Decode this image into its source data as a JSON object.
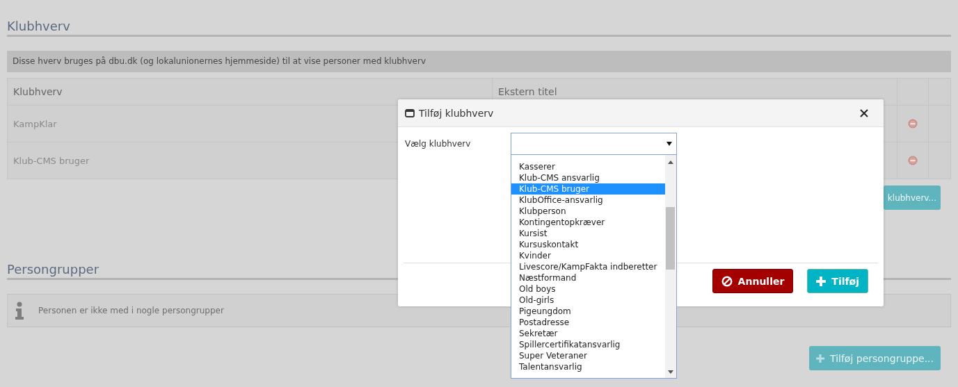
{
  "section_1": {
    "title": "Klubhverv",
    "info": "Disse hverv bruges på dbu.dk (og lokalunionernes hjemmeside) til at vise personer med klubhverv",
    "table": {
      "columns": [
        "Klubhverv",
        "Ekstern titel"
      ],
      "rows": [
        {
          "name": "KampKlar"
        },
        {
          "name": "Klub-CMS bruger"
        }
      ]
    },
    "add_button": "klubhverv..."
  },
  "section_2": {
    "title": "Persongrupper",
    "info": "Personen er ikke med i nogle persongrupper",
    "add_button": "Tilføj persongruppe..."
  },
  "dialog": {
    "title": "Tilføj klubhverv",
    "field_label": "Vælg klubhverv",
    "options": [
      {
        "label": "Kasserer",
        "selected": false
      },
      {
        "label": "Klub-CMS ansvarlig",
        "selected": false
      },
      {
        "label": "Klub-CMS bruger",
        "selected": true
      },
      {
        "label": "KlubOffice-ansvarlig",
        "selected": false
      },
      {
        "label": "Klubperson",
        "selected": false
      },
      {
        "label": "Kontingentopkræver",
        "selected": false
      },
      {
        "label": "Kursist",
        "selected": false
      },
      {
        "label": "Kursuskontakt",
        "selected": false
      },
      {
        "label": "Kvinder",
        "selected": false
      },
      {
        "label": "Livescore/KampFakta indberetter",
        "selected": false
      },
      {
        "label": "Næstformand",
        "selected": false
      },
      {
        "label": "Old boys",
        "selected": false
      },
      {
        "label": "Old-girls",
        "selected": false
      },
      {
        "label": "Pigeungdom",
        "selected": false
      },
      {
        "label": "Postadresse",
        "selected": false
      },
      {
        "label": "Sekretær",
        "selected": false
      },
      {
        "label": "Spillercertifikatansvarlig",
        "selected": false
      },
      {
        "label": "Super Veteraner",
        "selected": false
      },
      {
        "label": "Talentansvarlig",
        "selected": false
      }
    ],
    "cancel_button": "Annuller",
    "add_button": "Tilføj"
  }
}
